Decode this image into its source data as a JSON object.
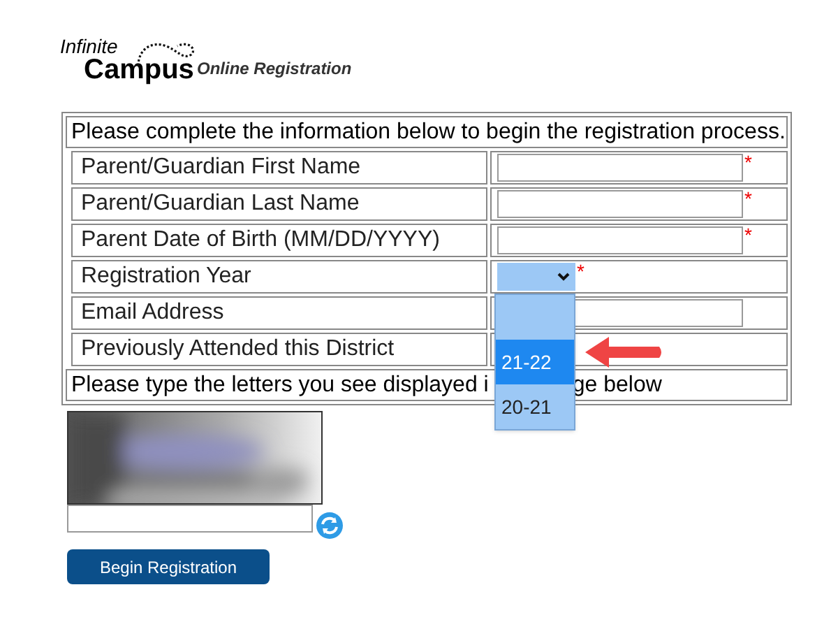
{
  "logo": {
    "line_1": "Infinite",
    "line_2": "Campus",
    "subtitle": "Online Registration"
  },
  "form": {
    "intro": "Please complete the information below to begin the registration process.",
    "rows": [
      {
        "label": "Parent/Guardian First Name",
        "kind": "text",
        "required_mark": "*"
      },
      {
        "label": "Parent/Guardian Last Name",
        "kind": "text",
        "required_mark": "*"
      },
      {
        "label": "Parent Date of Birth (MM/DD/YYYY)",
        "kind": "text",
        "required_mark": "*"
      },
      {
        "label": "Registration Year",
        "kind": "select",
        "required_mark": "*",
        "expanded": true,
        "options": [
          {
            "label": "21-22",
            "selected": true
          },
          {
            "label": "20-21",
            "selected": false
          }
        ]
      },
      {
        "label": "Email Address",
        "kind": "text"
      },
      {
        "label": "Previously Attended this District",
        "kind": "empty"
      }
    ],
    "footer_parts": [
      "Please type the letters you see displayed i",
      "ge below"
    ]
  },
  "button": "Begin Registration"
}
